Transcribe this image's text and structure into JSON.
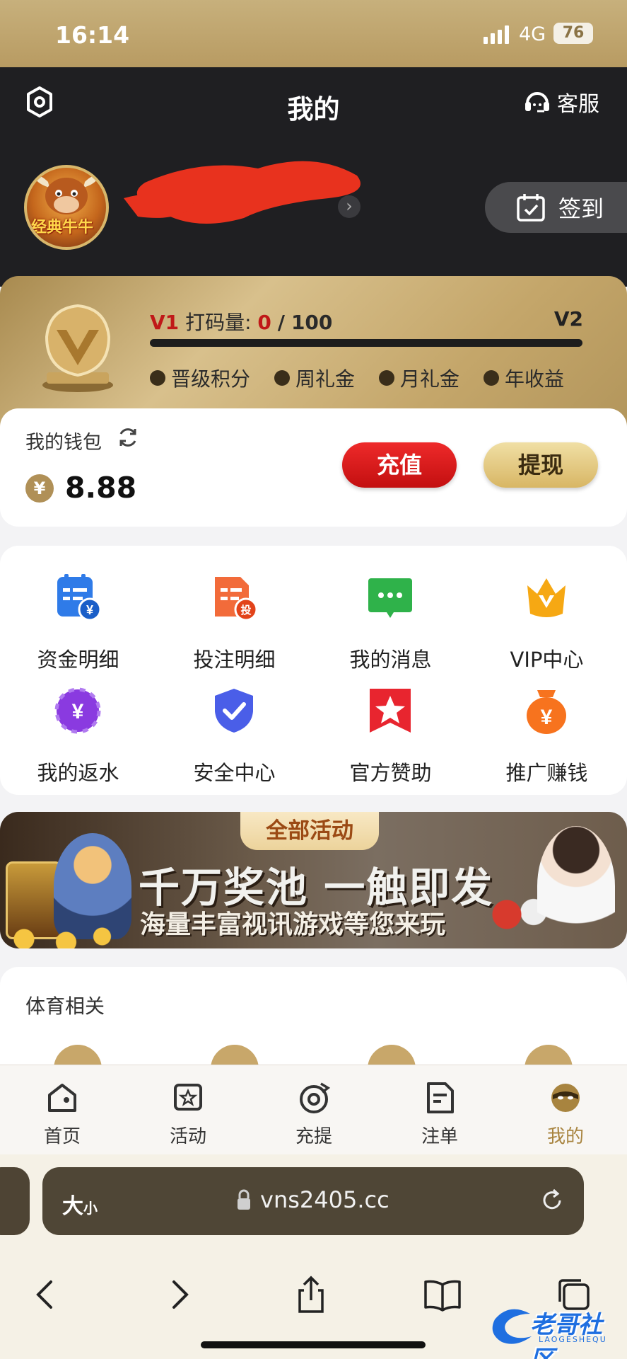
{
  "status_bar": {
    "time": "16:14",
    "network": "4G",
    "battery": "76"
  },
  "header": {
    "title": "我的",
    "service_label": "客服",
    "checkin_label": "签到"
  },
  "avatar": {
    "text": "经典牛牛"
  },
  "vip": {
    "level": "V1",
    "progress_label": "打码量:",
    "current": "0",
    "separator": "/",
    "total": "100",
    "next_level": "V2",
    "progress_fraction": 0,
    "perks": [
      "晋级积分",
      "周礼金",
      "月礼金",
      "年收益"
    ]
  },
  "wallet": {
    "title": "我的钱包",
    "currency_symbol": "¥",
    "balance": "8.88",
    "deposit_label": "充值",
    "withdraw_label": "提现"
  },
  "menu": {
    "items": [
      {
        "label": "资金明细",
        "icon": "fund-detail-icon",
        "color": "#2f7be8"
      },
      {
        "label": "投注明细",
        "icon": "bet-detail-icon",
        "color": "#f26b3a"
      },
      {
        "label": "我的消息",
        "icon": "message-icon",
        "color": "#2fb24a"
      },
      {
        "label": "VIP中心",
        "icon": "vip-crown-icon",
        "color": "#f6a813"
      },
      {
        "label": "我的返水",
        "icon": "rebate-icon",
        "color": "#8a3ae0"
      },
      {
        "label": "安全中心",
        "icon": "shield-icon",
        "color": "#4a5ee8"
      },
      {
        "label": "官方赞助",
        "icon": "star-badge-icon",
        "color": "#e8252f"
      },
      {
        "label": "推广赚钱",
        "icon": "promote-money-icon",
        "color": "#f7731e"
      }
    ],
    "bet_badge": "投",
    "yen_glyph": "¥"
  },
  "banner": {
    "tab": "全部活动",
    "headline": "千万奖池 一触即发",
    "subline": "海量丰富视讯游戏等您来玩"
  },
  "sports": {
    "title": "体育相关"
  },
  "tabbar": {
    "items": [
      {
        "label": "首页",
        "icon": "home-icon"
      },
      {
        "label": "活动",
        "icon": "activity-icon"
      },
      {
        "label": "充提",
        "icon": "deposit-withdraw-icon"
      },
      {
        "label": "注单",
        "icon": "orders-icon"
      },
      {
        "label": "我的",
        "icon": "profile-icon",
        "active": true
      }
    ],
    "active_color": "#a8843f"
  },
  "browser": {
    "aa_big": "大",
    "aa_small": "小",
    "url": "vns2405.cc"
  },
  "watermark": {
    "text": "老哥社区",
    "sub": "LAOGESHEQU"
  },
  "colors": {
    "gold": "#c8a76a",
    "header_bg": "#1f1f22",
    "deposit_red": "#d11a1b"
  }
}
